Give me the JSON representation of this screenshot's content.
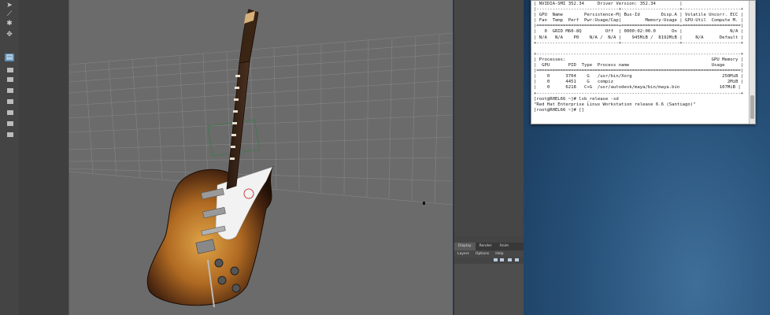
{
  "maya": {
    "panel_tabs": [
      "Display",
      "Render",
      "Anim"
    ],
    "panel_menu": [
      "Layers",
      "Options",
      "Help"
    ]
  },
  "terminal": {
    "lines": [
      "| NVIDIA-SMI 352.34     Driver Version: 352.34         |",
      "|-------------------------------+----------------------+----------------------+",
      "| GPU  Name        Persistence-M| Bus-Id        Disp.A | Volatile Uncorr. ECC |",
      "| Fan  Temp  Perf  Pwr:Usage/Cap|         Memory-Usage | GPU-Util  Compute M. |",
      "|===============================+======================+======================|",
      "|   0  GRID M60-8Q         Off  | 0000:02:00.0      On |                  N/A |",
      "| N/A   N/A    P0    N/A /  N/A |    945MiB /  8192MiB |     N/A      Default |",
      "+-------------------------------+----------------------+----------------------+",
      "",
      "+-----------------------------------------------------------------------------+",
      "| Processes:                                                       GPU Memory |",
      "|  GPU       PID  Type  Process name                               Usage      |",
      "|=============================================================================|",
      "|    0      3704    G   /usr/bin/Xorg                                  250MiB |",
      "|    0      4451    G   compiz                                           2MiB |",
      "|    0      6218   C+G  /usr/autodesk/maya/bin/maya.bin               107MiB |",
      "+-----------------------------------------------------------------------------+",
      "[root@RHEL66 ~]# lsb_release -sd",
      "\"Red Hat Enterprise Linux Workstation release 6.6 (Santiago)\"",
      "[root@RHEL66 ~]# []"
    ]
  },
  "colors": {
    "desktop": "#28527a",
    "viewport": "#6b6b6b",
    "sunburst_center": "#d99a3a",
    "sunburst_edge": "#2a1608",
    "pickguard": "#f2f2f2",
    "selection": "#5c8fb8"
  },
  "icons": [
    "select-arrow-icon",
    "lasso-icon",
    "paint-icon",
    "move-icon",
    "rotate-icon",
    "scale-icon",
    "layout-icon"
  ]
}
